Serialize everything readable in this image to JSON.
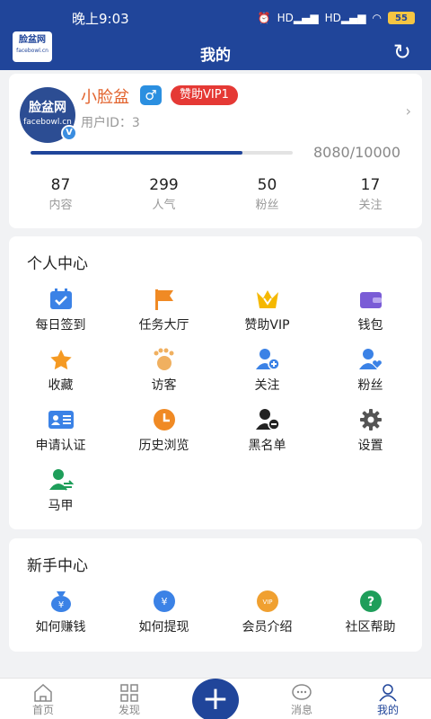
{
  "status": {
    "time": "晚上9:03",
    "battery": "55",
    "signal_1": "HD",
    "signal_2": "HD"
  },
  "logo": {
    "title": "脸盆网",
    "site": "facebowl.cn",
    "badge": "V"
  },
  "header": {
    "title": "我的"
  },
  "profile": {
    "username": "小脸盆",
    "gender": "♂",
    "vip": "赞助VIP1",
    "user_id": "用户ID：3",
    "progress_value": 8080,
    "progress_max": 10000,
    "progress_text": "8080/10000",
    "stats": [
      {
        "value": "87",
        "label": "内容"
      },
      {
        "value": "299",
        "label": "人气"
      },
      {
        "value": "50",
        "label": "粉丝"
      },
      {
        "value": "17",
        "label": "关注"
      }
    ]
  },
  "personal": {
    "title": "个人中心",
    "items": [
      {
        "label": "每日签到",
        "icon": "calendar-check-icon"
      },
      {
        "label": "任务大厅",
        "icon": "flag-icon"
      },
      {
        "label": "赞助VIP",
        "icon": "crown-icon"
      },
      {
        "label": "钱包",
        "icon": "wallet-icon"
      },
      {
        "label": "收藏",
        "icon": "star-icon"
      },
      {
        "label": "访客",
        "icon": "footprint-icon"
      },
      {
        "label": "关注",
        "icon": "user-plus-icon"
      },
      {
        "label": "粉丝",
        "icon": "user-heart-icon"
      },
      {
        "label": "申请认证",
        "icon": "id-card-icon"
      },
      {
        "label": "历史浏览",
        "icon": "clock-icon"
      },
      {
        "label": "黑名单",
        "icon": "user-block-icon"
      },
      {
        "label": "设置",
        "icon": "gear-icon"
      },
      {
        "label": "马甲",
        "icon": "user-switch-icon"
      }
    ]
  },
  "newbie": {
    "title": "新手中心",
    "items": [
      {
        "label": "如何赚钱",
        "icon": "money-bag-icon"
      },
      {
        "label": "如何提现",
        "icon": "withdraw-icon"
      },
      {
        "label": "会员介绍",
        "icon": "vip-icon"
      },
      {
        "label": "社区帮助",
        "icon": "help-icon"
      }
    ]
  },
  "tabs": [
    {
      "label": "首页",
      "icon": "home-icon"
    },
    {
      "label": "发现",
      "icon": "grid-icon"
    },
    {
      "label": "消息",
      "icon": "chat-icon"
    },
    {
      "label": "我的",
      "icon": "user-icon",
      "active": true
    }
  ],
  "colors": {
    "primary": "#20459a",
    "vip_red": "#e53935",
    "name_orange": "#e2622c"
  }
}
